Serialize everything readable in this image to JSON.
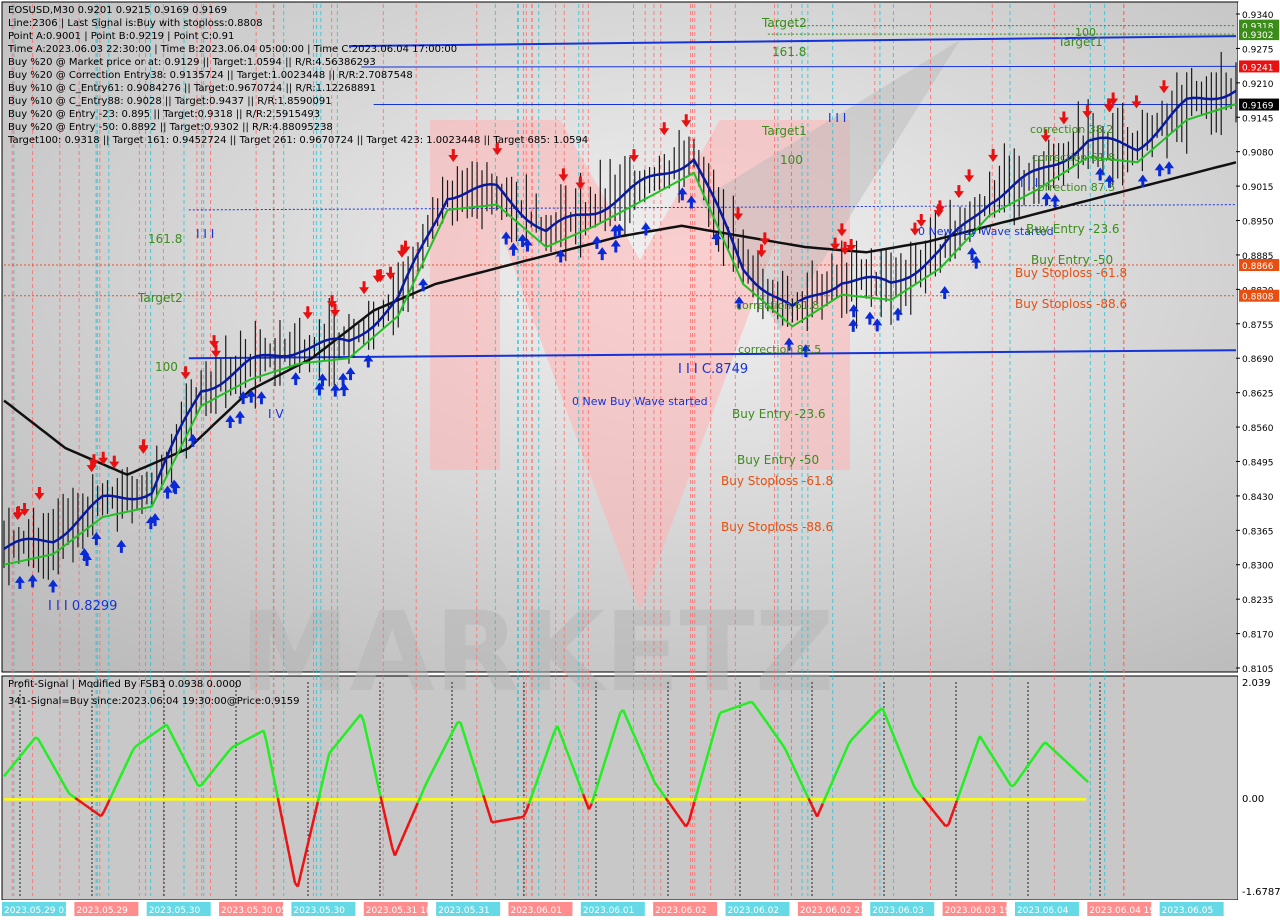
{
  "colors": {
    "background": "#d0d0d0",
    "frame": "#000000",
    "grid": "#a8a8a8",
    "vline_red": "#ff6b6b",
    "vline_cyan": "#27c4d6",
    "candle": "#1a1a1a",
    "ma_navy": "#0a1aa0",
    "ma_green": "#22c022",
    "ma_black": "#111111",
    "level_blue": "#1633d8",
    "level_red": "#e8502a",
    "label_green": "#3c8c1a",
    "label_orange": "#e84e10",
    "osc_green": "#22ee22",
    "osc_red": "#ee1111",
    "osc_zero": "#ffff00",
    "arrow_up": "#0a2ad8",
    "arrow_down": "#e81010",
    "watermark_red": "#ffb0b0",
    "watermark_gray": "#b4b4b4"
  },
  "header": {
    "symbol_line": "EOSUSD,M30  0.9201 0.9215 0.9169 0.9169",
    "info_lines": [
      "Line:2306  | Last Signal is:Buy with stoploss:0.8808",
      "Point A:0.9001 | Point B:0.9219 | Point C:0.91",
      "Time A:2023.06.03 22:30:00 | Time B:2023.06.04 05:00:00 | Time C:2023.06.04 17:00:00",
      "Buy %20 @ Market price or at: 0.9129 || Target:1.0594 || R/R:4.56386293",
      "Buy %20 @ Correction Entry38: 0.9135724 || Target:1.0023448 || R/R:2.7087548",
      "Buy %10 @ C_Entry61: 0.9084276 || Target:0.9670724 || R/R:1.12268891",
      "Buy %10 @ C_Entry88: 0.9028 || Target:0.9437 || R/R:1.8590091",
      "Buy %20 @ Entry -23: 0.895 || Target:0.9318 || R/R:2.5915493",
      "Buy %20 @ Entry -50: 0.8892 || Target:0.9302 || R/R:4.88095238",
      "Target100: 0.9318 || Target 161: 0.9452724 || Target 261: 0.9670724 || Target 423: 1.0023448 || Target 685: 1.0594"
    ]
  },
  "oscillator": {
    "title": "Profit-Signal | Modified By FSB3 0.0938 0.0000",
    "signal_line": "341-Signal=Buy since:2023.06.04 19:30:00@Price:0.9159",
    "scale": [
      "2.039",
      "0.00",
      "-1.6787"
    ]
  },
  "price_axis": {
    "ticks": [
      "0.9340",
      "0.9275",
      "0.9210",
      "0.9145",
      "0.9080",
      "0.9015",
      "0.8950",
      "0.8885",
      "0.8820",
      "0.8755",
      "0.8690",
      "0.8625",
      "0.8560",
      "0.8495",
      "0.8430",
      "0.8365",
      "0.8300",
      "0.8235",
      "0.8170",
      "0.8105"
    ],
    "tags": [
      {
        "text": "0.9318",
        "value": 0.9318,
        "color": "#3c8c1a"
      },
      {
        "text": "0.9302",
        "value": 0.9302,
        "color": "#3c8c1a"
      },
      {
        "text": "0.9241",
        "value": 0.9241,
        "color": "#e81010"
      },
      {
        "text": "0.9169",
        "value": 0.9169,
        "color": "#000000"
      },
      {
        "text": "0.8866",
        "value": 0.8866,
        "color": "#e84e10"
      },
      {
        "text": "0.8808",
        "value": 0.8808,
        "color": "#e84e10"
      }
    ]
  },
  "time_axis_labels": [
    "2023.05.29 01:00",
    "2023.05.29",
    "2023.05.30",
    "2023.05.30 05:30",
    "2023.05.30",
    "2023.05.31 18:30",
    "2023.05.31",
    "2023.06.01",
    "2023.06.01",
    "2023.06.02",
    "2023.06.02",
    "2023.06.02 21:30",
    "2023.06.03",
    "2023.06.03 19:00",
    "2023.06.04",
    "2023.06.04 19:30",
    "2023.06.05"
  ],
  "annotations": {
    "target2_top": "Target2",
    "level_161_top": "161.8",
    "target1_mid": "Target1",
    "level_100_mid": "100",
    "level_161_left": "161.8",
    "target2_left": "Target2",
    "level_100_left": "100",
    "triple_bar_left": "I I I",
    "triple_bar_mid": "I I I",
    "triple_bar_right": "I I I",
    "v_mark_left": "I V",
    "low_label": "I I I 0.8299",
    "mid_low_label": "I I I C.8749",
    "new_wave_1": "0 New Buy Wave started",
    "new_wave_2": "0 New Buy Wave started",
    "correction_61_mid": "correction 61.8",
    "correction_87_mid": "correction 87.5",
    "buy_entry_23_mid": "Buy Entry -23.6",
    "buy_entry_50_mid": "Buy Entry -50",
    "buy_stoploss_61_mid": "Buy Stoploss -61.8",
    "buy_stoploss_88_mid": "Buy Stoploss -88.6",
    "target1_right": "Target1",
    "level_100_right": "100",
    "correction_38_right": "correction 38.2",
    "correction_61_right": "correction 61.8",
    "correction_87_right": "correction 87.5",
    "buy_entry_23_right": "Buy Entry -23.6",
    "buy_entry_50_right": "Buy Entry -50",
    "buy_stoploss_61_right": "Buy Stoploss -61.8",
    "buy_stoploss_88_right": "Buy Stoploss -88.6"
  },
  "chart_data": [
    {
      "type": "line",
      "panel": "main",
      "title": "EOSUSD,M30",
      "ylim": [
        0.8105,
        0.934
      ],
      "x_range": [
        0,
        100
      ],
      "series": [
        {
          "name": "",
          "kind": "price",
          "x": [
            0,
            4,
            8,
            12,
            16,
            20,
            24,
            28,
            32,
            36,
            40,
            44,
            48,
            52,
            56,
            60,
            64,
            68,
            72,
            76,
            80,
            84,
            88,
            92,
            96,
            100
          ],
          "values": [
            0.833,
            0.835,
            0.842,
            0.844,
            0.863,
            0.868,
            0.871,
            0.872,
            0.88,
            0.9,
            0.901,
            0.893,
            0.897,
            0.902,
            0.907,
            0.886,
            0.878,
            0.884,
            0.883,
            0.889,
            0.899,
            0.904,
            0.91,
            0.909,
            0.917,
            0.92
          ]
        },
        {
          "kind": "ma_black",
          "x": [
            0,
            5,
            10,
            15,
            20,
            25,
            30,
            35,
            40,
            45,
            50,
            55,
            60,
            65,
            70,
            75,
            80,
            85,
            90,
            95,
            100
          ],
          "values": [
            0.861,
            0.852,
            0.847,
            0.852,
            0.863,
            0.869,
            0.878,
            0.883,
            0.886,
            0.889,
            0.892,
            0.894,
            0.892,
            0.89,
            0.889,
            0.891,
            0.894,
            0.897,
            0.9,
            0.903,
            0.906
          ]
        }
      ],
      "levels": [
        {
          "value": 0.9302,
          "label": "Target2 / 161.8"
        },
        {
          "value": 0.869,
          "label": "100"
        },
        {
          "value": 0.8866,
          "label": "Buy Stoploss -61.8"
        },
        {
          "value": 0.8808,
          "label": "Buy Stoploss -88.6"
        }
      ]
    },
    {
      "type": "line",
      "panel": "oscillator",
      "title": "Profit-Signal | Modified By FSB3 0.0938 0.0000",
      "ylim": [
        -1.6787,
        2.039
      ],
      "series": [
        {
          "name": "",
          "x": [
            0,
            3,
            6,
            9,
            12,
            15,
            18,
            21,
            24,
            27,
            30,
            33,
            36,
            39,
            42,
            45,
            48,
            51,
            54,
            57,
            60,
            63,
            66,
            69,
            72,
            75,
            78,
            81,
            84,
            87,
            90,
            93,
            96,
            100
          ],
          "values": [
            0.4,
            1.1,
            0.1,
            -0.3,
            0.9,
            1.3,
            0.2,
            0.9,
            1.2,
            -1.6,
            0.8,
            1.5,
            -1.0,
            0.3,
            1.4,
            -0.4,
            -0.3,
            1.3,
            -0.2,
            1.6,
            0.3,
            -0.5,
            1.5,
            1.7,
            0.9,
            -0.3,
            1.0,
            1.6,
            0.2,
            -0.5,
            1.1,
            0.2,
            1.0,
            0.3
          ]
        }
      ]
    }
  ]
}
